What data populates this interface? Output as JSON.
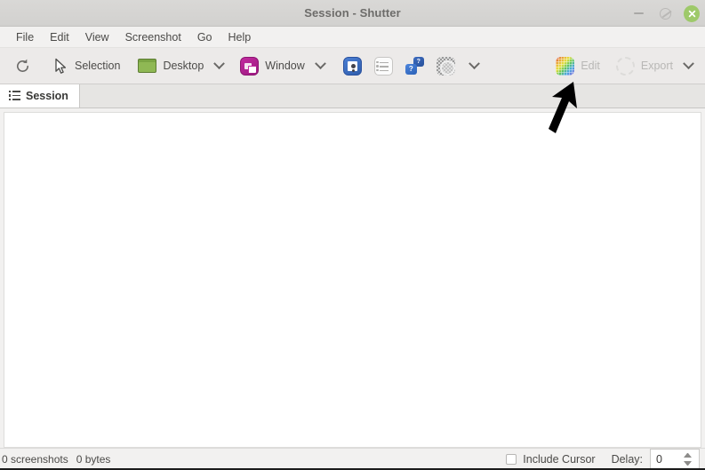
{
  "window": {
    "title": "Session - Shutter",
    "controls": {
      "minimize": "minimize-button",
      "maximize": "maximize-button",
      "close": "close-button"
    }
  },
  "menubar": {
    "items": [
      {
        "label": "File"
      },
      {
        "label": "Edit"
      },
      {
        "label": "View"
      },
      {
        "label": "Screenshot"
      },
      {
        "label": "Go"
      },
      {
        "label": "Help"
      }
    ]
  },
  "toolbar": {
    "refresh": {
      "icon": "refresh-icon",
      "label": ""
    },
    "selection": {
      "icon": "cursor-icon",
      "label": "Selection"
    },
    "desktop": {
      "icon": "desktop-icon",
      "label": "Desktop",
      "dropdown": "chevron-down-icon"
    },
    "window": {
      "icon": "window-icon",
      "label": "Window",
      "dropdown": "chevron-down-icon"
    },
    "web": {
      "icon": "web-icon"
    },
    "menu": {
      "icon": "menu-list-icon"
    },
    "tooltip": {
      "icon": "tooltip-question-icon"
    },
    "redo": {
      "icon": "transparency-circle-icon"
    },
    "more_dropdown": {
      "icon": "chevron-down-icon"
    },
    "edit": {
      "icon": "edit-palette-icon",
      "label": "Edit",
      "disabled": true
    },
    "export": {
      "icon": "export-circle-icon",
      "label": "Export",
      "disabled": true
    },
    "export_dropdown": {
      "icon": "chevron-down-icon"
    }
  },
  "tabs": [
    {
      "label": "Session",
      "icon": "session-list-icon",
      "active": true
    }
  ],
  "canvas": {
    "content": ""
  },
  "statusbar": {
    "screenshot_count": "0 screenshots",
    "total_size": "0 bytes",
    "include_cursor_label": "Include Cursor",
    "include_cursor_checked": false,
    "delay_label": "Delay:",
    "delay_value": "0"
  },
  "annotation": {
    "arrow": "up-right-arrow-annotation",
    "points_to": "Edit"
  },
  "colors": {
    "titlebar": "#d6d5d3",
    "toolbar": "#eceae9",
    "close_button": "#9ec96a",
    "desktop_icon": "#8fb854",
    "window_icon": "#c32aa0",
    "web_icon": "#3a6cc4",
    "canvas": "#ffffff",
    "text": "#4b4a48",
    "disabled_text": "#b8b7b5"
  }
}
